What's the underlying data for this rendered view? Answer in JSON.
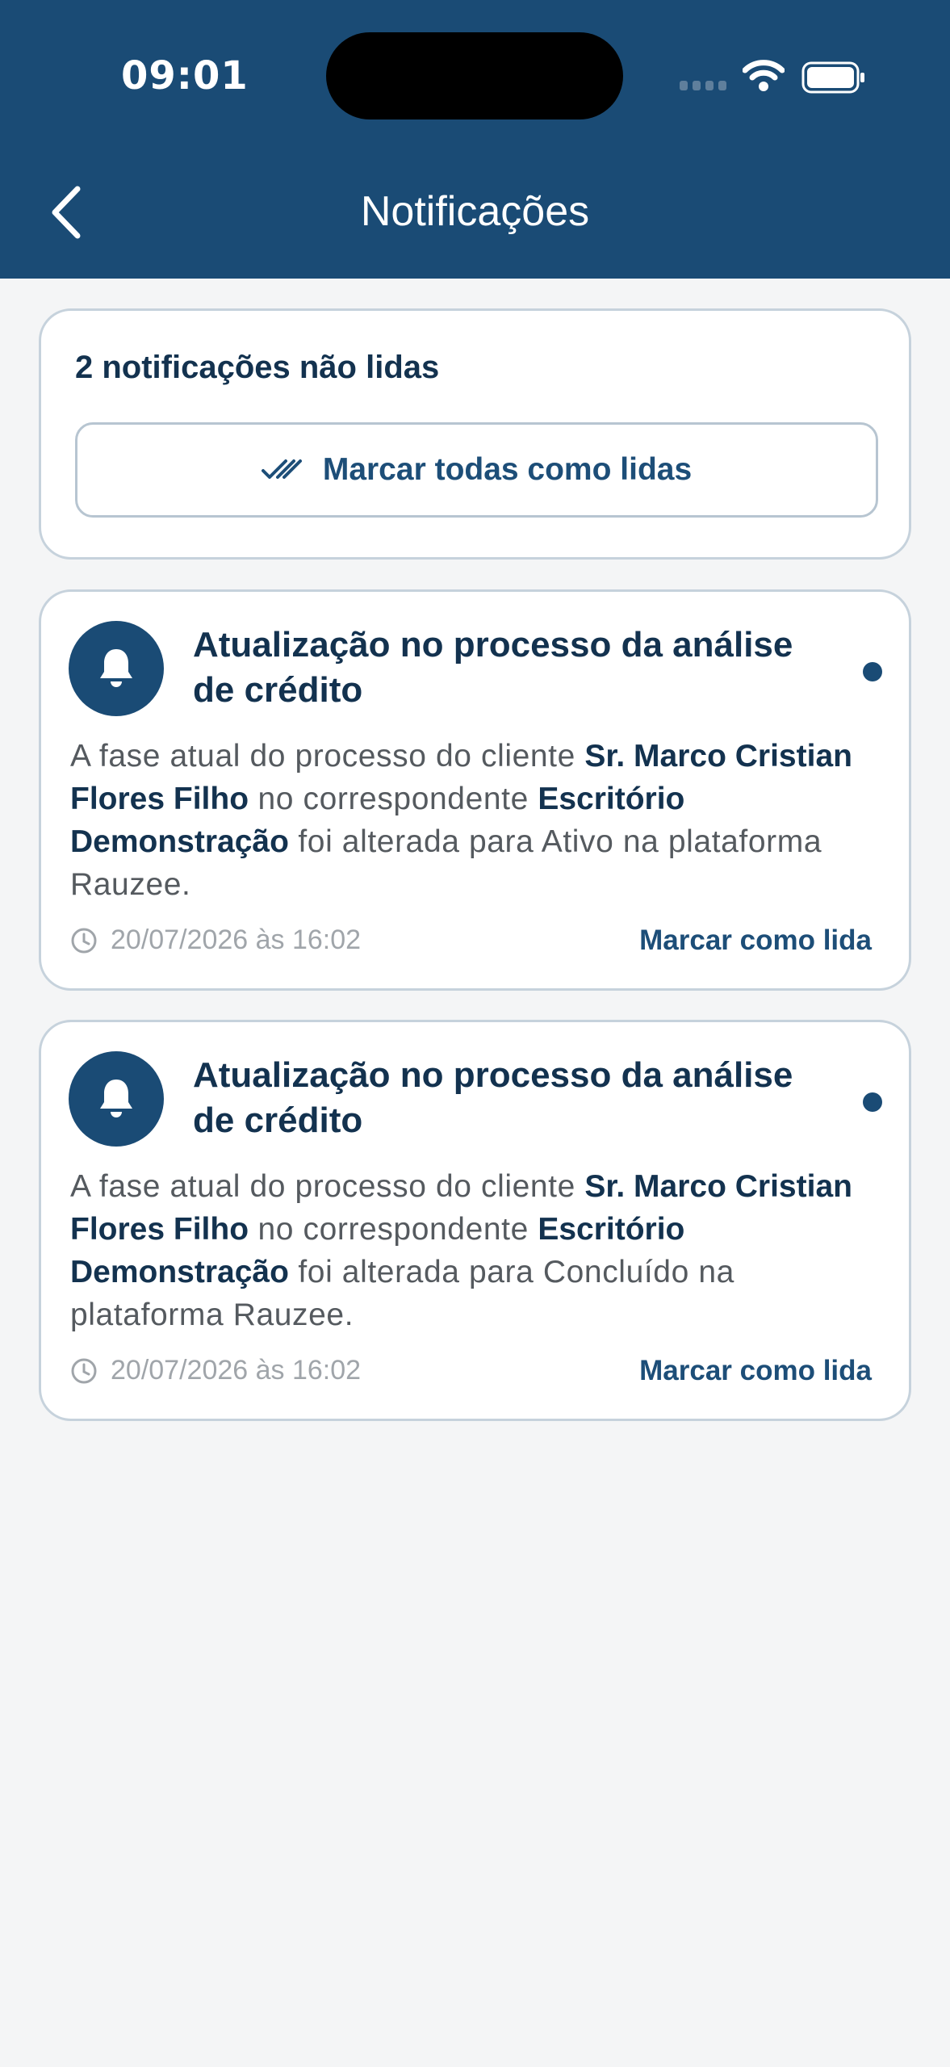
{
  "status_bar": {
    "time": "09:01"
  },
  "header": {
    "title": "Notificações"
  },
  "summary": {
    "unread_label": "2 notificações não lidas",
    "mark_all_label": "Marcar todas como lidas"
  },
  "notifications": [
    {
      "title": "Atualização no processo da análise de crédito",
      "body": {
        "p1": "A fase atual do processo do cliente ",
        "client": "Sr. Marco Cristian Flores Filho",
        "p2": " no correspondente ",
        "office": "Escritório Demonstração",
        "p3": " foi alterada para Ativo na plataforma Rauzee."
      },
      "timestamp": "20/07/2026 às 16:02",
      "mark_read_label": "Marcar como lida",
      "unread": true
    },
    {
      "title": "Atualização no processo da análise de crédito",
      "body": {
        "p1": "A fase atual do processo do cliente ",
        "client": "Sr. Marco Cristian Flores Filho",
        "p2": " no correspondente ",
        "office": "Escritório Demonstração",
        "p3": " foi alterada para Concluído na plataforma Rauzee."
      },
      "timestamp": "20/07/2026 às 16:02",
      "mark_read_label": "Marcar como lida",
      "unread": true
    }
  ],
  "colors": {
    "primary": "#1a4b75",
    "background": "#f4f5f6",
    "card_border": "#c6d2dc",
    "title_text": "#13324f",
    "body_text": "#555a5f",
    "muted_text": "#a0a5aa"
  },
  "icons": {
    "back": "chevron-left-icon",
    "mark_all": "double-check-icon",
    "avatar": "bell-icon",
    "timestamp": "clock-icon",
    "status": [
      "signal-icon",
      "wifi-icon",
      "battery-icon"
    ]
  }
}
